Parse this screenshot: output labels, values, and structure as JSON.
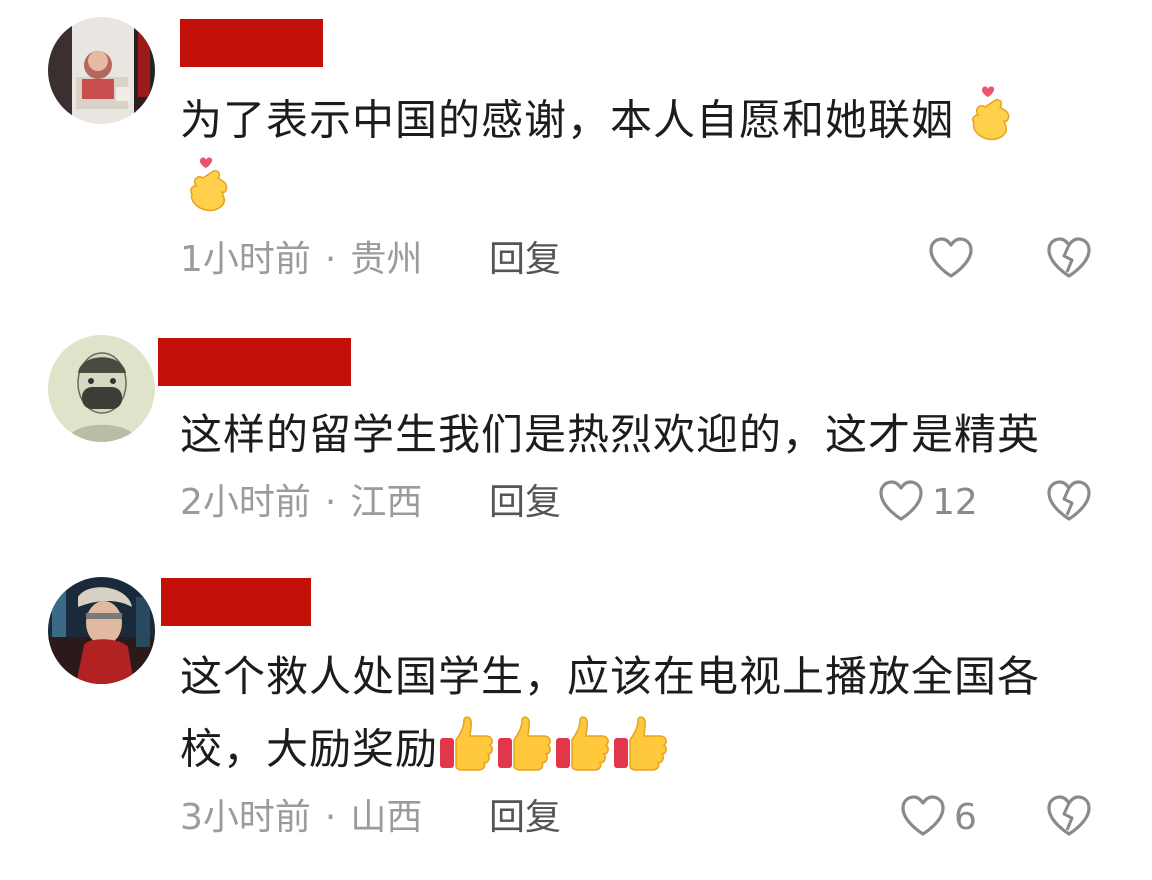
{
  "comments": [
    {
      "text_line1": "为了表示中国的感谢，本人自愿和她联姻",
      "time": "1小时前",
      "location": "贵州",
      "reply_label": "回复",
      "like_count": "",
      "emoji_line1": [
        "finger-heart-icon"
      ],
      "emoji_line2": [
        "finger-heart-icon"
      ]
    },
    {
      "text_line1": "这样的留学生我们是热烈欢迎的，这才是精英",
      "time": "2小时前",
      "location": "江西",
      "reply_label": "回复",
      "like_count": "12"
    },
    {
      "text_line1": "这个救人处国学生，应该在电视上播放全国各",
      "text_line2": "校，大励奖励",
      "time": "3小时前",
      "location": "山西",
      "reply_label": "回复",
      "like_count": "6",
      "emoji_line2": [
        "thumbs-up-icon",
        "thumbs-up-icon",
        "thumbs-up-icon",
        "thumbs-up-icon"
      ]
    }
  ],
  "meta_separator": "·",
  "colors": {
    "redaction": "#c20f07",
    "text": "#1c1c1c",
    "meta": "#9b9b9b",
    "icon_stroke": "#8a8a8a"
  }
}
